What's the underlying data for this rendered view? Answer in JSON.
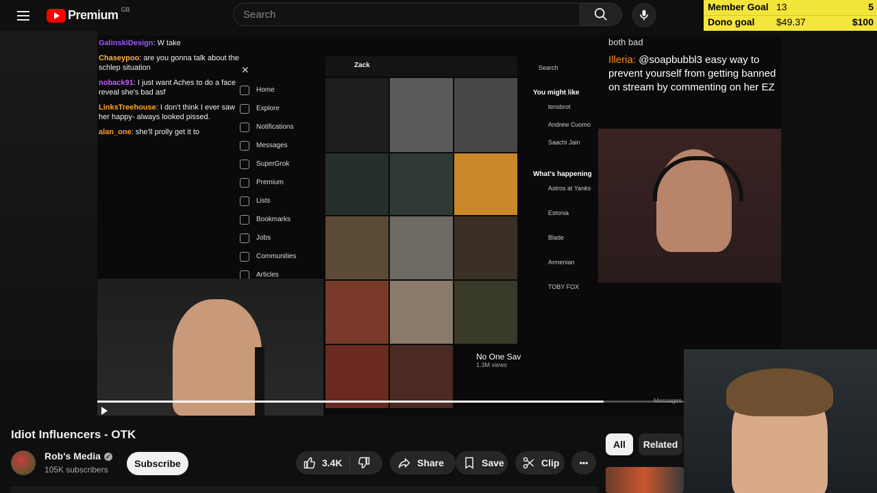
{
  "header": {
    "logo_text": "Premium",
    "region": "GB",
    "search_placeholder": "Search"
  },
  "goals": {
    "member": {
      "label": "Member Goal",
      "current": "13",
      "target": "5"
    },
    "dono": {
      "label": "Dono goal",
      "current": "$49.37",
      "target": "$100"
    }
  },
  "video": {
    "chat": [
      {
        "name": "GalinskiDesign",
        "color": "#9b59ff",
        "text": ": W take"
      },
      {
        "name": "Chaseypoo",
        "color": "#ffb347",
        "text": ": are you gonna talk about the schlep situation"
      },
      {
        "name": "noback91",
        "color": "#c45cff",
        "text": ": I just want Aches to do a face reveal she's bad asf"
      },
      {
        "name": "LinksTreehouse",
        "color": "#ffa62b",
        "text": ": I don't think I ever saw her happy- always looked pissed."
      },
      {
        "name": "alan_one",
        "color": "#ff9d3c",
        "text": ": she'll prolly get it to"
      }
    ],
    "x_nav": [
      "Home",
      "Explore",
      "Notifications",
      "Messages",
      "SuperGrok",
      "Premium",
      "Lists",
      "Bookmarks",
      "Jobs",
      "Communities",
      "Articles"
    ],
    "x_profile": "Zack",
    "right_pane": {
      "search": "Search",
      "might_like": "You might like",
      "suggested": [
        "tensbrot",
        "Andrew Cuomo",
        "Saachi Jain"
      ],
      "happening": "What's happening",
      "trends": [
        "Astros at Yanks",
        "Estonia",
        "Blade",
        "Armenian",
        "TOBY FOX"
      ],
      "messages": "Messages"
    },
    "clip_label": "No One Sav",
    "clip_views": "1.3M views",
    "stream_chat": {
      "partial_top": "both bad",
      "name": "Illeria:",
      "text": "@soapbubbl3 easy way to prevent yourself from getting banned on stream by commenting on her EZ"
    },
    "progress_fraction": 0.74
  },
  "title": "Idiot Influencers - OTK",
  "channel": {
    "name": "Rob's Media",
    "subscribers": "105K subscribers",
    "verified_glyph": "✓"
  },
  "actions": {
    "subscribe": "Subscribe",
    "likes": "3.4K",
    "share": "Share",
    "save": "Save",
    "clip": "Clip",
    "more": "•••"
  },
  "chips": {
    "all": "All",
    "related": "Related"
  },
  "colors": {
    "accent": "#ff0000",
    "goal_bar": "#f4e53a",
    "chat_name": "#ff8c1a"
  }
}
